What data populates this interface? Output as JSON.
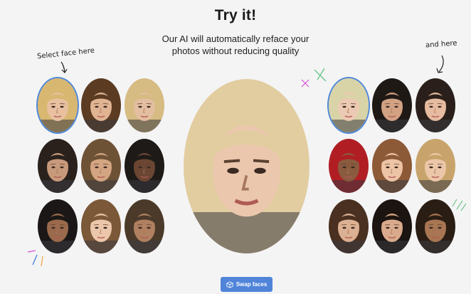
{
  "header": {
    "title": "Try it!",
    "subtitle": "Our AI will automatically reface your photos without reducing quality"
  },
  "hints": {
    "left": "Select face here",
    "right": "and here"
  },
  "swap_button": {
    "label": "Swap faces",
    "icon": "cube-icon"
  },
  "colors": {
    "accent": "#4f84d9",
    "selected_outline": "#4d87d6",
    "background": "#f4f4f5"
  },
  "source_faces": {
    "selected_index": 0,
    "items": [
      {
        "name": "face-1",
        "hair": "#d8b770",
        "skin": "#e8c0a0"
      },
      {
        "name": "face-2",
        "hair": "#5b3b22",
        "skin": "#e0b393"
      },
      {
        "name": "face-3",
        "hair": "#d6bb82",
        "skin": "#e4bea0"
      },
      {
        "name": "face-4",
        "hair": "#2a211c",
        "skin": "#c79a7b"
      },
      {
        "name": "face-5",
        "hair": "#6e5236",
        "skin": "#d4a582"
      },
      {
        "name": "face-6",
        "hair": "#1e1a18",
        "skin": "#6b4632"
      },
      {
        "name": "face-7",
        "hair": "#1b1716",
        "skin": "#9b6a4c"
      },
      {
        "name": "face-8",
        "hair": "#7a5838",
        "skin": "#ecc6aa"
      },
      {
        "name": "face-9",
        "hair": "#4b3a2a",
        "skin": "#b08060"
      }
    ]
  },
  "target_faces": {
    "selected_index": 0,
    "items": [
      {
        "name": "face-10",
        "hair": "#d9d3a8",
        "skin": "#ecc9b2"
      },
      {
        "name": "face-11",
        "hair": "#1e1915",
        "skin": "#d3a283"
      },
      {
        "name": "face-12",
        "hair": "#2a1f1a",
        "skin": "#e6bba0"
      },
      {
        "name": "face-13",
        "hair": "#b01e24",
        "skin": "#8a5b3f"
      },
      {
        "name": "face-14",
        "hair": "#8d5a38",
        "skin": "#eec4a6"
      },
      {
        "name": "face-15",
        "hair": "#c8a46c",
        "skin": "#ecc6a8"
      },
      {
        "name": "face-16",
        "hair": "#4a3020",
        "skin": "#dcb092"
      },
      {
        "name": "face-17",
        "hair": "#1c1410",
        "skin": "#d9aa8c"
      },
      {
        "name": "face-18",
        "hair": "#2a1d14",
        "skin": "#a87652"
      }
    ]
  },
  "result": {
    "hair": "#e2cda0",
    "skin": "#ebc7ad"
  }
}
